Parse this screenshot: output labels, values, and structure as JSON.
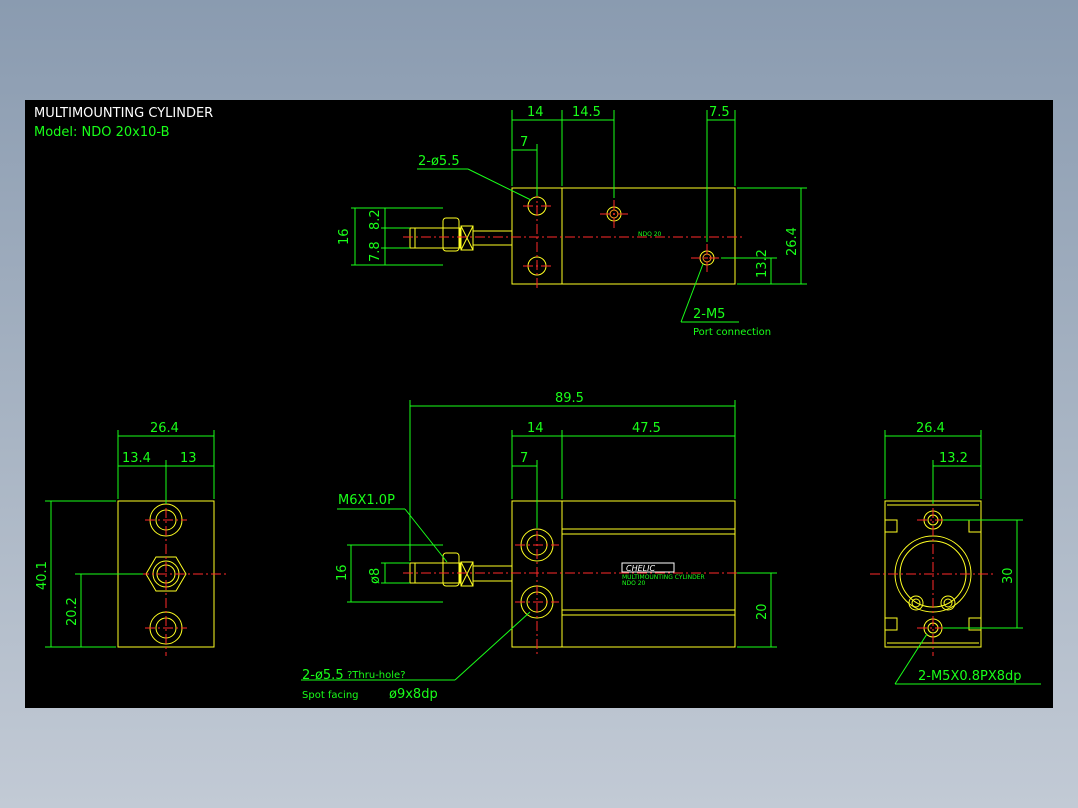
{
  "title_block": {
    "title": "MULTIMOUNTING CYLINDER",
    "model": "Model:  NDO 20x10-B"
  },
  "top_view": {
    "dims": {
      "d14": "14",
      "d14_5": "14.5",
      "d7_5": "7.5",
      "d7": "7",
      "d16": "16",
      "d7_8": "7.8",
      "d8_2": "8.2",
      "d26_4": "26.4",
      "d13_2": "13.2"
    },
    "hole_callout": "2-ø5.5",
    "port_callout": "2-M5",
    "port_note": "Port connection",
    "body_label": "NDO 20"
  },
  "left_view": {
    "dims": {
      "d26_4": "26.4",
      "d13_4": "13.4",
      "d13": "13",
      "d40_1": "40.1",
      "d20_2": "20.2"
    }
  },
  "front_view": {
    "dims": {
      "d89_5": "89.5",
      "d14": "14",
      "d47_5": "47.5",
      "d7": "7",
      "d16": "16",
      "d8": "ø8",
      "d20": "20"
    },
    "thread_callout": "M6X1.0P",
    "hole_callout": "2-ø5.5",
    "hole_note": "?Thru-hole?",
    "spot_label": "Spot facing",
    "spot_value": "ø9x8dp",
    "brand": "CHELIC",
    "brand_sub1": "MULTIMOUNTING CYLINDER",
    "brand_sub2": "NDO 20"
  },
  "right_view": {
    "dims": {
      "d26_4": "26.4",
      "d13_2": "13.2",
      "d30": "30"
    },
    "port_callout": "2-M5X0.8PX8dp"
  },
  "colors": {
    "background": "#000000",
    "dimension": "#19ff19",
    "outline": "#ffff22",
    "centerline": "#ff2a2a",
    "title_text": "#ffffff"
  }
}
